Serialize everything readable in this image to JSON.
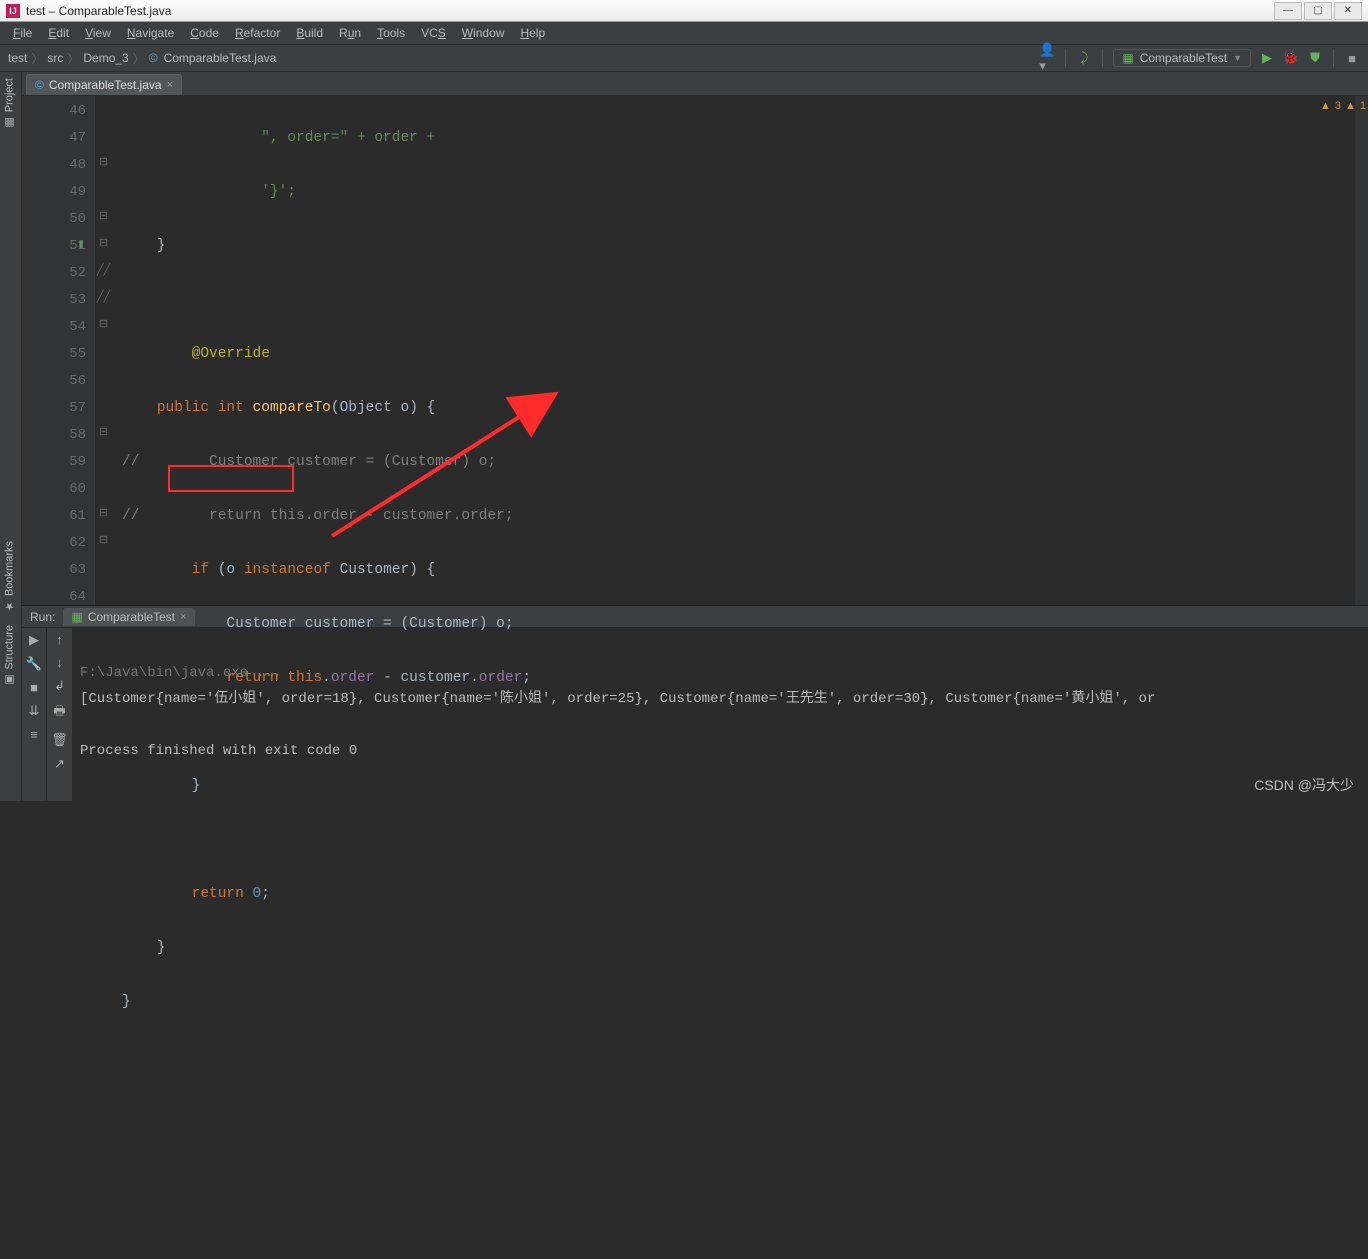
{
  "window": {
    "title": "test – ComparableTest.java"
  },
  "menu": [
    "File",
    "Edit",
    "View",
    "Navigate",
    "Code",
    "Refactor",
    "Build",
    "Run",
    "Tools",
    "VCS",
    "Window",
    "Help"
  ],
  "breadcrumbs": [
    "test",
    "src",
    "Demo_3",
    "ComparableTest.java"
  ],
  "toolbar": {
    "run_config": "ComparableTest"
  },
  "editor": {
    "tab": "ComparableTest.java",
    "first_line": 46,
    "lines": {
      "l46": "                \", order=\" + order +",
      "l47": "                '}';",
      "l48": "    }",
      "l49": "",
      "l50": "    @Override",
      "l51a": "public ",
      "l51b": "int ",
      "l51c": "compareTo",
      "l51d": "(Object o) {",
      "l52": "//        Customer customer = (Customer) o;",
      "l53": "//        return this.order - customer.order;",
      "l54a": "if ",
      "l54b": "(o ",
      "l54c": "instanceof ",
      "l54d": "Customer) {",
      "l55": "            Customer customer = (Customer) o;",
      "l56a": "return ",
      "l56b": "this",
      "l56c": ".",
      "l56d": "order",
      "l56e": " - customer.",
      "l56f": "order",
      "l56g": ";",
      "l57": "",
      "l58": "        }",
      "l59": "",
      "l60a": "return ",
      "l60b": "0",
      "l60c": ";",
      "l61": "    }",
      "l62": "}",
      "l63": "",
      "l64": ""
    },
    "lint": {
      "warnA": "3",
      "warnB": "1"
    }
  },
  "run": {
    "title": "Run:",
    "tab": "ComparableTest",
    "out1": "F:\\Java\\bin\\java.exe ...",
    "out2": "[Customer{name='伍小姐', order=18}, Customer{name='陈小姐', order=25}, Customer{name='王先生', order=30}, Customer{name='黄小姐', or",
    "out3": "Process finished with exit code 0"
  },
  "leftTools": [
    "Project",
    "Bookmarks",
    "Structure"
  ],
  "watermark": "CSDN @冯大少"
}
